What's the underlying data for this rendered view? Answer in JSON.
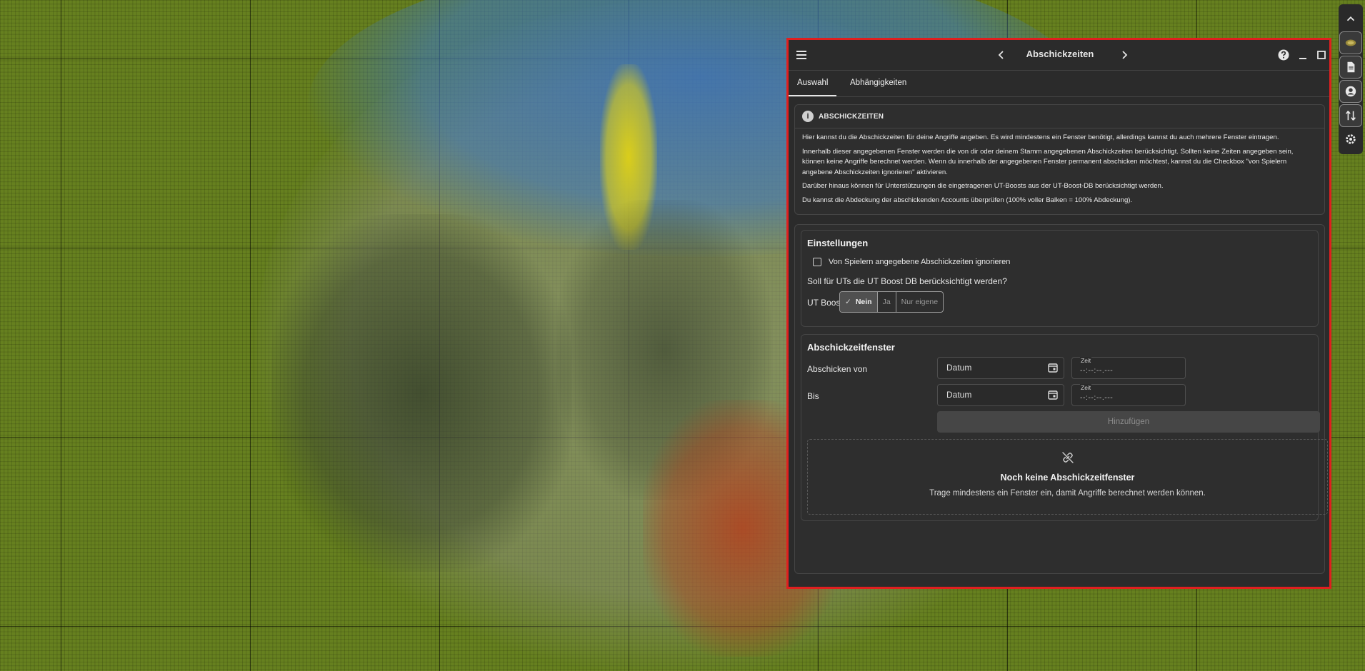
{
  "panel": {
    "title": "Abschickzeiten",
    "border_color": "#e01f1f",
    "background_color": "#2b2b2b"
  },
  "tabs": [
    {
      "label": "Auswahl",
      "active": true
    },
    {
      "label": "Abhängigkeiten",
      "active": false
    }
  ],
  "info": {
    "title": "ABSCHICKZEITEN",
    "paragraphs": [
      "Hier kannst du die Abschickzeiten für deine Angriffe angeben. Es wird mindestens ein Fenster benötigt, allerdings kannst du auch mehrere Fenster eintragen.",
      "Innerhalb dieser angegebenen Fenster werden die von dir oder deinem Stamm angegebenen Abschickzeiten berücksichtigt. Sollten keine Zeiten angegeben sein, können keine Angriffe berechnet werden. Wenn du innerhalb der angegebenen Fenster permanent abschicken möchtest, kannst du die Checkbox \"von Spielern angebene Abschickzeiten ignorieren\" aktivieren.",
      "Darüber hinaus können für Unterstützungen die eingetragenen UT-Boosts aus der UT-Boost-DB berücksichtigt werden.",
      "Du kannst die Abdeckung der abschickenden Accounts überprüfen (100% voller Balken = 100% Abdeckung)."
    ]
  },
  "settings": {
    "title": "Einstellungen",
    "ignore_checkbox_label": "Von Spielern angegebene Abschickzeiten ignorieren",
    "ignore_checked": false,
    "ut_question": "Soll für UTs die UT Boost DB berücksichtigt werden?",
    "ut_label": "UT Boost",
    "ut_options": [
      "Nein",
      "Ja",
      "Nur eigene"
    ],
    "ut_selected": "Nein"
  },
  "windows": {
    "title": "Abschickzeitfenster",
    "from_label": "Abschicken von",
    "to_label": "Bis",
    "date_placeholder": "Datum",
    "time_label": "Zeit",
    "time_placeholder": "--:--:--.---",
    "add_label": "Hinzufügen",
    "empty_title": "Noch keine Abschickzeitfenster",
    "empty_text": "Trage mindestens ein Fenster ein, damit Angriffe berechnet werden können."
  },
  "toolbar": {
    "icons": [
      "chevron-up-icon",
      "world-map-icon",
      "document-icon",
      "user-icon",
      "transfer-icon",
      "gear-icon"
    ]
  },
  "map": {
    "ground_color": "#66801f"
  }
}
